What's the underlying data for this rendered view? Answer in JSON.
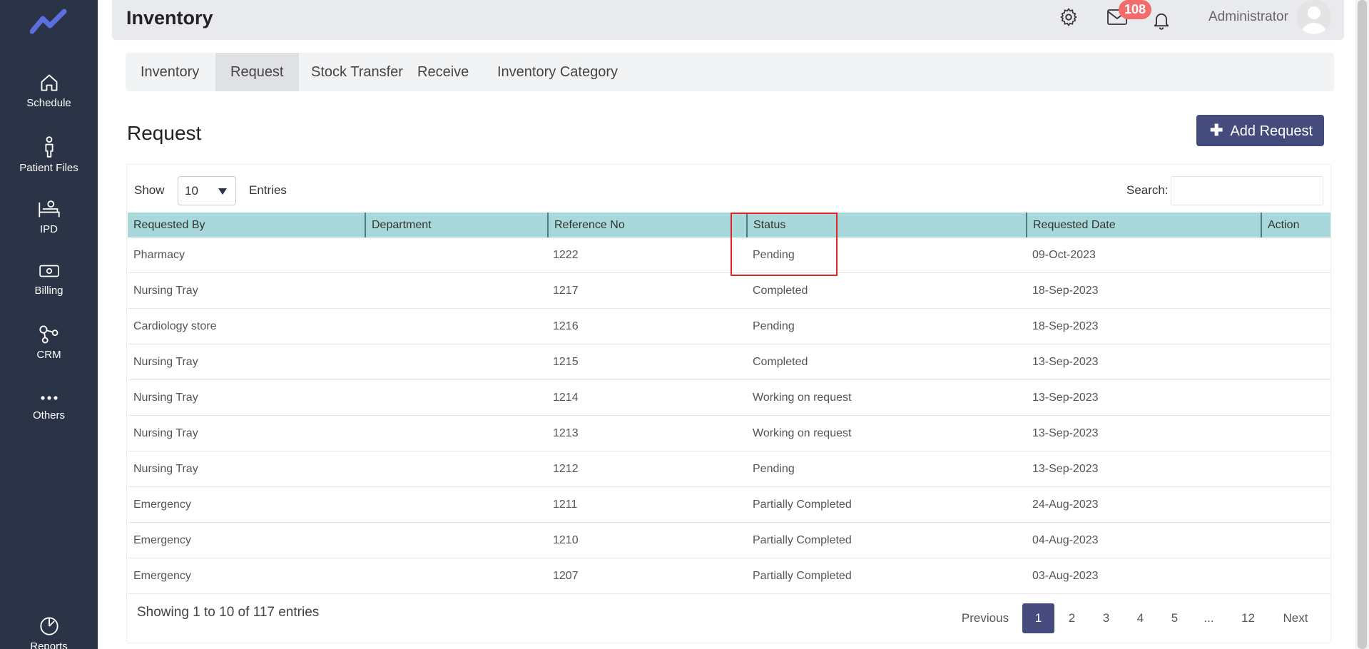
{
  "sidebar": {
    "items": [
      {
        "label": "Schedule",
        "icon": "home-icon"
      },
      {
        "label": "Patient Files",
        "icon": "person-icon"
      },
      {
        "label": "IPD",
        "icon": "bed-icon"
      },
      {
        "label": "Billing",
        "icon": "money-icon"
      },
      {
        "label": "CRM",
        "icon": "network-icon"
      },
      {
        "label": "Others",
        "icon": "more-icon"
      },
      {
        "label": "Reports",
        "icon": "chart-icon"
      }
    ]
  },
  "header": {
    "title": "Inventory",
    "notification_count": "108",
    "user_name": "Administrator"
  },
  "tabs": [
    {
      "label": "Inventory"
    },
    {
      "label": "Request"
    },
    {
      "label": "Stock Transfer"
    },
    {
      "label": "Receive"
    },
    {
      "label": "Inventory Category"
    }
  ],
  "section": {
    "title": "Request",
    "add_button": "Add Request"
  },
  "controls": {
    "show_label": "Show",
    "entries_value": "10",
    "entries_label": "Entries",
    "search_label": "Search:"
  },
  "table": {
    "columns": [
      "Requested By",
      "Department",
      "Reference No",
      "Status",
      "Requested Date",
      "Action"
    ],
    "rows": [
      {
        "by": "Pharmacy",
        "dept": "",
        "ref": "1222",
        "status": "Pending",
        "date": "09-Oct-2023"
      },
      {
        "by": "Nursing Tray",
        "dept": "",
        "ref": "1217",
        "status": "Completed",
        "date": "18-Sep-2023"
      },
      {
        "by": "Cardiology store",
        "dept": "",
        "ref": "1216",
        "status": "Pending",
        "date": "18-Sep-2023"
      },
      {
        "by": "Nursing Tray",
        "dept": "",
        "ref": "1215",
        "status": "Completed",
        "date": "13-Sep-2023"
      },
      {
        "by": "Nursing Tray",
        "dept": "",
        "ref": "1214",
        "status": "Working on request",
        "date": "13-Sep-2023"
      },
      {
        "by": "Nursing Tray",
        "dept": "",
        "ref": "1213",
        "status": "Working on request",
        "date": "13-Sep-2023"
      },
      {
        "by": "Nursing Tray",
        "dept": "",
        "ref": "1212",
        "status": "Pending",
        "date": "13-Sep-2023"
      },
      {
        "by": "Emergency",
        "dept": "",
        "ref": "1211",
        "status": "Partially Completed",
        "date": "24-Aug-2023"
      },
      {
        "by": "Emergency",
        "dept": "",
        "ref": "1210",
        "status": "Partially Completed",
        "date": "04-Aug-2023"
      },
      {
        "by": "Emergency",
        "dept": "",
        "ref": "1207",
        "status": "Partially Completed",
        "date": "03-Aug-2023"
      }
    ]
  },
  "footer": {
    "showing_text": "Showing 1 to 10 of 117 entries",
    "pagination": [
      "Previous",
      "1",
      "2",
      "3",
      "4",
      "5",
      "...",
      "12",
      "Next"
    ]
  },
  "colors": {
    "sidebar_bg": "#2b3347",
    "accent": "#454b7c",
    "table_header": "#a8d8d9",
    "badge": "#f36b6b"
  }
}
